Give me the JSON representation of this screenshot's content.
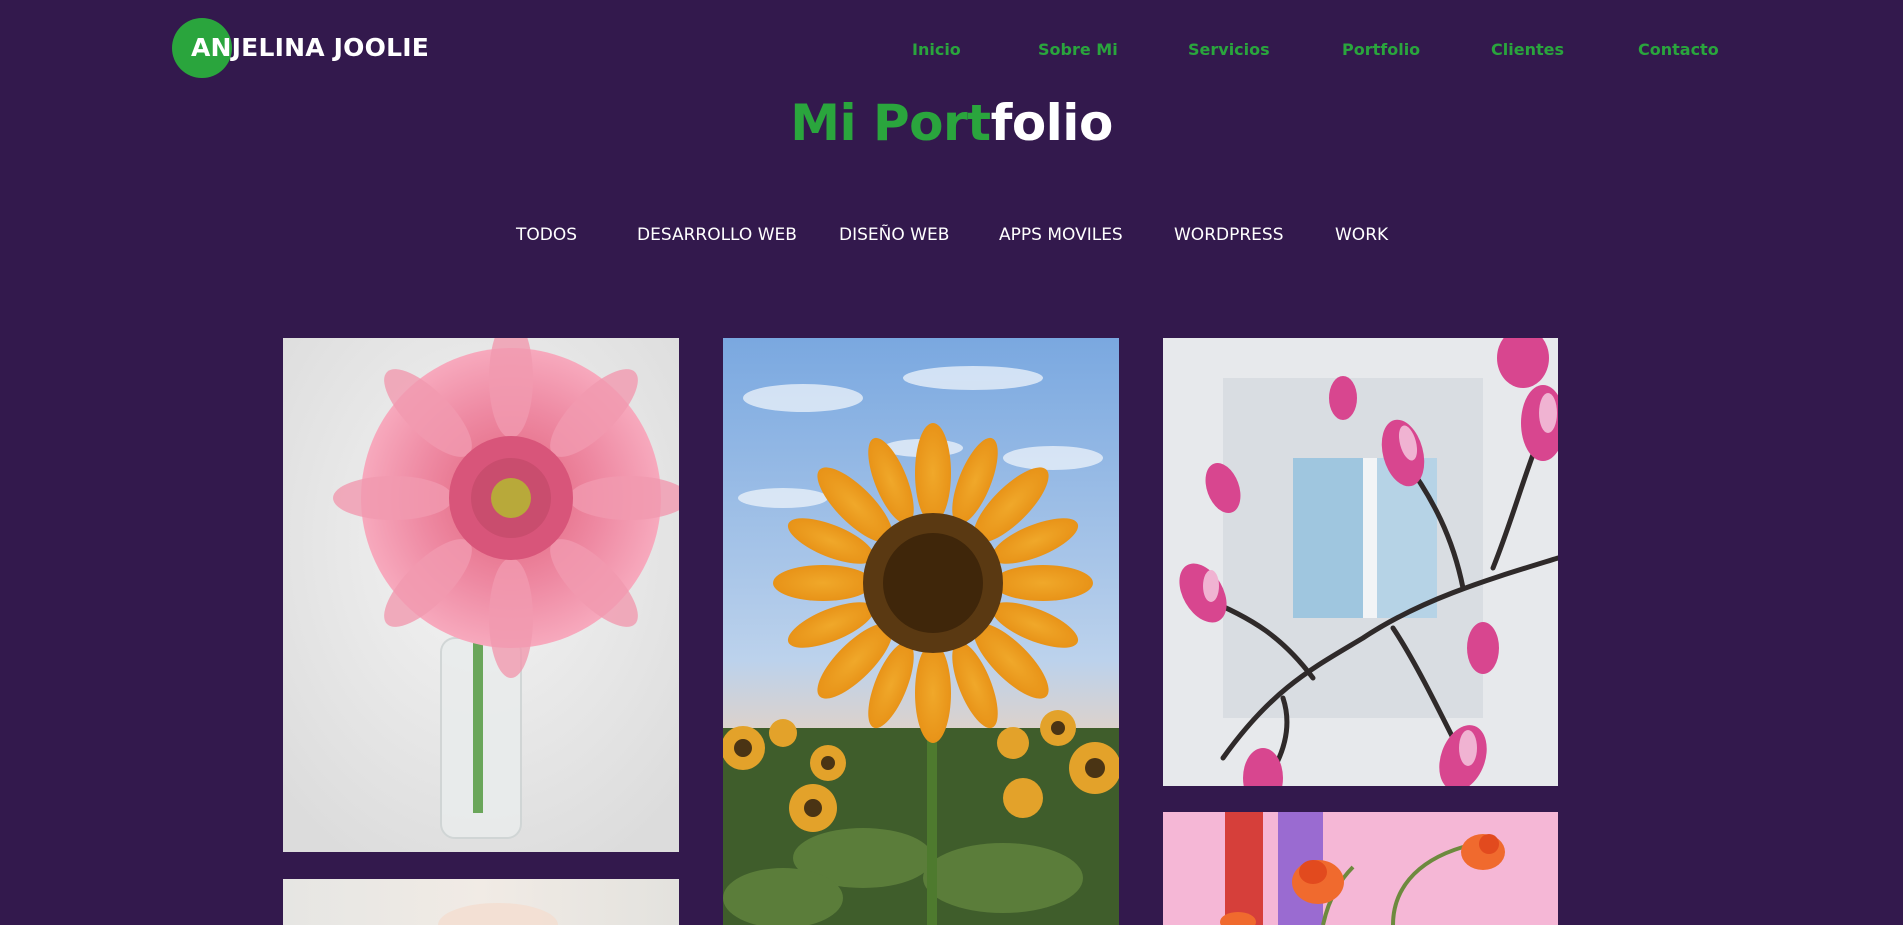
{
  "header": {
    "logo_text": "ANJELINA JOOLIE",
    "nav": [
      {
        "label": "Inicio"
      },
      {
        "label": "Sobre Mi"
      },
      {
        "label": "Servicios"
      },
      {
        "label": "Portfolio"
      },
      {
        "label": "Clientes"
      },
      {
        "label": "Contacto"
      }
    ]
  },
  "title": {
    "part_green": "Mi Port",
    "part_white": "folio"
  },
  "filters": [
    {
      "label": "TODOS"
    },
    {
      "label": "DESARROLLO WEB"
    },
    {
      "label": "DISEÑO WEB"
    },
    {
      "label": "APPS MOVILES"
    },
    {
      "label": "WORDPRESS"
    },
    {
      "label": "WORK"
    }
  ],
  "gallery": [
    {
      "subject": "pink-gerbera-photo"
    },
    {
      "subject": "sunflower-photo"
    },
    {
      "subject": "magnolia-branch-photo"
    },
    {
      "subject": "light-flower-photo"
    },
    {
      "subject": "orange-poppies-photo"
    }
  ],
  "colors": {
    "background": "#33194d",
    "accent": "#2aa53d",
    "text": "#ffffff"
  }
}
